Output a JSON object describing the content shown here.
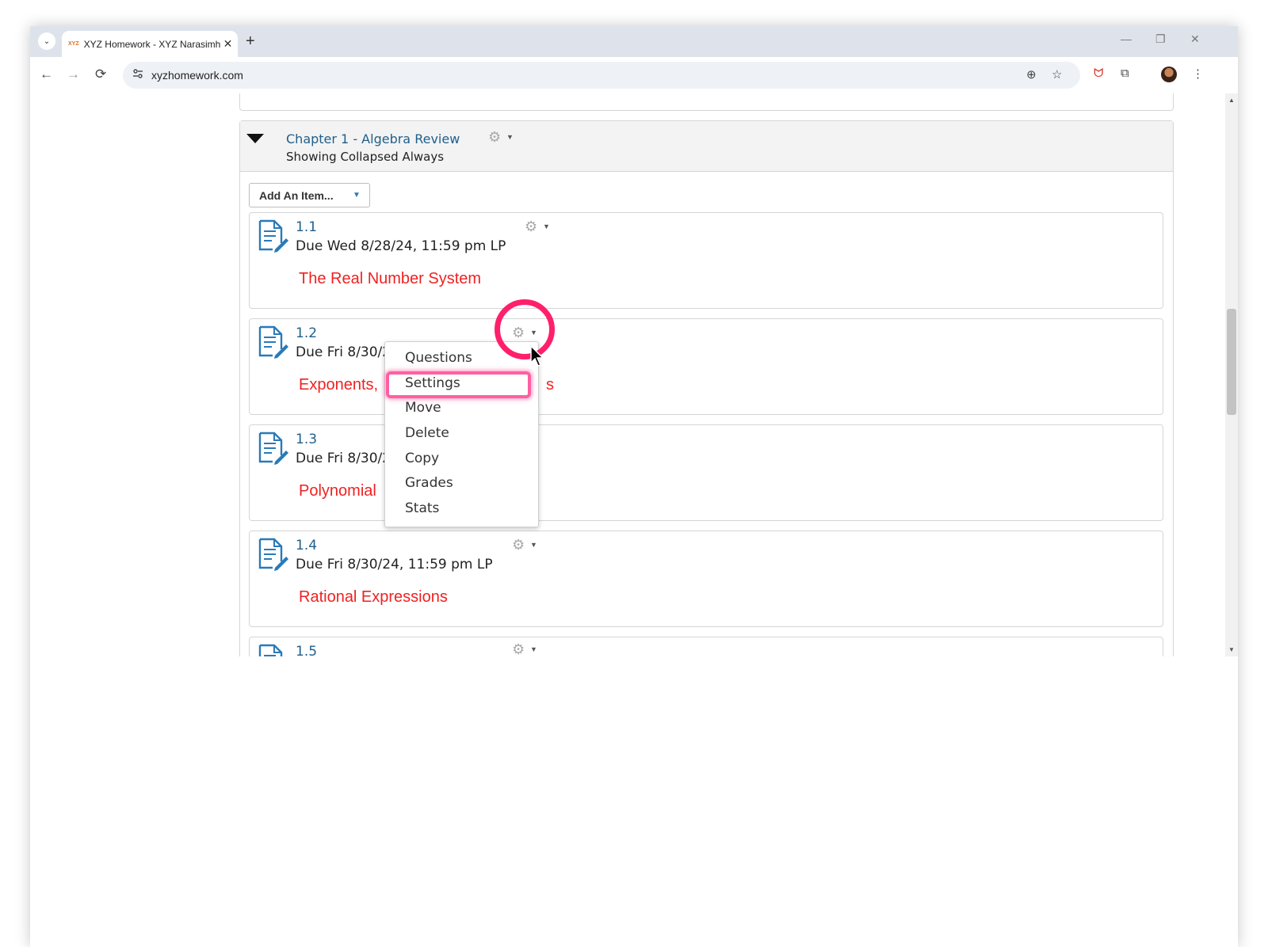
{
  "browser": {
    "tab_favicon": "XYZ",
    "tab_title": "XYZ Homework - XYZ Narasimh",
    "tab_close": "✕",
    "new_tab": "+",
    "tab_dropdown": "⌄",
    "url": "xyzhomework.com",
    "controls": {
      "minimize": "—",
      "restore": "❐",
      "close": "✕"
    },
    "nav": {
      "back": "←",
      "forward": "→",
      "reload": "⟳"
    },
    "toolbar_icons": {
      "zoom": "⊕",
      "star": "☆",
      "extension1": "ᗢ",
      "extensions": "⧉",
      "menu": "⋮"
    }
  },
  "chapter": {
    "title": "Chapter 1 - Algebra Review",
    "subtitle": "Showing Collapsed Always"
  },
  "add_item": {
    "label": "Add An Item...",
    "caret": "▼"
  },
  "items": [
    {
      "num": "1.1",
      "due": "Due Wed 8/28/24, 11:59 pm LP",
      "topic": "The Real Number System"
    },
    {
      "num": "1.2",
      "due": "Due Fri 8/30/2",
      "topic": "Exponents,"
    },
    {
      "num": "1.3",
      "due": "Due Fri 8/30/2",
      "topic": "Polynomial"
    },
    {
      "num": "1.4",
      "due": "Due Fri 8/30/24, 11:59 pm LP",
      "topic": "Rational Expressions"
    },
    {
      "num": "1.5",
      "due": "",
      "topic": ""
    }
  ],
  "item_1_2_topic_tail": "s",
  "gear_glyph": "⚙",
  "caret_glyph": "▼",
  "dropdown_menu": [
    "Questions",
    "Settings",
    "Move",
    "Delete",
    "Copy",
    "Grades",
    "Stats"
  ],
  "colors": {
    "link": "#1f5f8b",
    "topic": "#ee2222",
    "highlight": "#ff1f6b"
  }
}
